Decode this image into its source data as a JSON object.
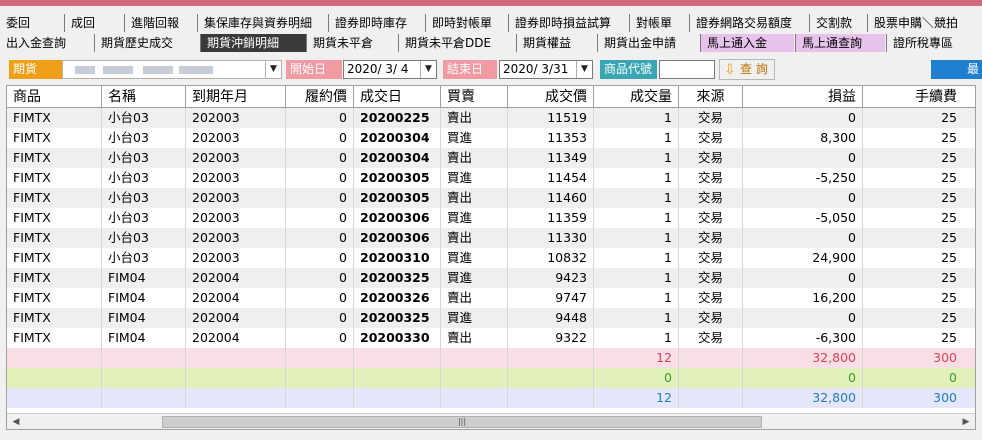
{
  "menu_row1": [
    "委回",
    "成回",
    "進階回報",
    "集保庫存與資券明細",
    "證券即時庫存",
    "即時對帳單",
    "證券即時損益試算",
    "對帳單",
    "證券網路交易額度",
    "交割款",
    "股票申購＼競拍"
  ],
  "menu_row2": [
    "出入金查詢",
    "期貨歷史成交",
    "期貨沖銷明細",
    "期貨未平倉",
    "期貨未平倉DDE",
    "期貨權益",
    "期貨出金申請",
    "馬上通入金",
    "馬上通查詢",
    "證所稅專區"
  ],
  "filter": {
    "futures_label": "期貨",
    "start_label": "開始日",
    "start_date": "2020/ 3/ 4",
    "end_label": "結束日",
    "end_date": "2020/ 3/31",
    "code_label": "商品代號",
    "code_value": "",
    "query_label": "查 詢",
    "right_label": "最"
  },
  "table": {
    "headers": [
      "商品",
      "名稱",
      "到期年月",
      "履約價",
      "成交日",
      "買賣",
      "成交價",
      "成交量",
      "來源",
      "損益",
      "手續費"
    ],
    "rows": [
      [
        "FIMTX",
        "小台03",
        "202003",
        "0",
        "20200225",
        "賣出",
        "11519",
        "1",
        "交易",
        "0",
        "25"
      ],
      [
        "FIMTX",
        "小台03",
        "202003",
        "0",
        "20200304",
        "買進",
        "11353",
        "1",
        "交易",
        "8,300",
        "25"
      ],
      [
        "FIMTX",
        "小台03",
        "202003",
        "0",
        "20200304",
        "賣出",
        "11349",
        "1",
        "交易",
        "0",
        "25"
      ],
      [
        "FIMTX",
        "小台03",
        "202003",
        "0",
        "20200305",
        "買進",
        "11454",
        "1",
        "交易",
        "-5,250",
        "25"
      ],
      [
        "FIMTX",
        "小台03",
        "202003",
        "0",
        "20200305",
        "賣出",
        "11460",
        "1",
        "交易",
        "0",
        "25"
      ],
      [
        "FIMTX",
        "小台03",
        "202003",
        "0",
        "20200306",
        "買進",
        "11359",
        "1",
        "交易",
        "-5,050",
        "25"
      ],
      [
        "FIMTX",
        "小台03",
        "202003",
        "0",
        "20200306",
        "賣出",
        "11330",
        "1",
        "交易",
        "0",
        "25"
      ],
      [
        "FIMTX",
        "小台03",
        "202003",
        "0",
        "20200310",
        "買進",
        "10832",
        "1",
        "交易",
        "24,900",
        "25"
      ],
      [
        "FIMTX",
        "FIM04",
        "202004",
        "0",
        "20200325",
        "買進",
        "9423",
        "1",
        "交易",
        "0",
        "25"
      ],
      [
        "FIMTX",
        "FIM04",
        "202004",
        "0",
        "20200326",
        "賣出",
        "9747",
        "1",
        "交易",
        "16,200",
        "25"
      ],
      [
        "FIMTX",
        "FIM04",
        "202004",
        "0",
        "20200325",
        "買進",
        "9448",
        "1",
        "交易",
        "0",
        "25"
      ],
      [
        "FIMTX",
        "FIM04",
        "202004",
        "0",
        "20200330",
        "賣出",
        "9322",
        "1",
        "交易",
        "-6,300",
        "25"
      ]
    ],
    "summary": [
      {
        "qty": "12",
        "pnl": "32,800",
        "fee": "300",
        "color": "#e0405a"
      },
      {
        "qty": "0",
        "pnl": "0",
        "fee": "0",
        "color": "#3aa030"
      },
      {
        "qty": "12",
        "pnl": "32,800",
        "fee": "300",
        "color": "#1f7fc0"
      }
    ]
  },
  "colors": {
    "accent_bar": "#d36a7a",
    "futures_label": "#f0a018",
    "date_label": "#f19aa2",
    "code_label": "#3aa6b4",
    "active_tab": "#3a3a3a",
    "highlight_tab": "#e7c3ec"
  }
}
